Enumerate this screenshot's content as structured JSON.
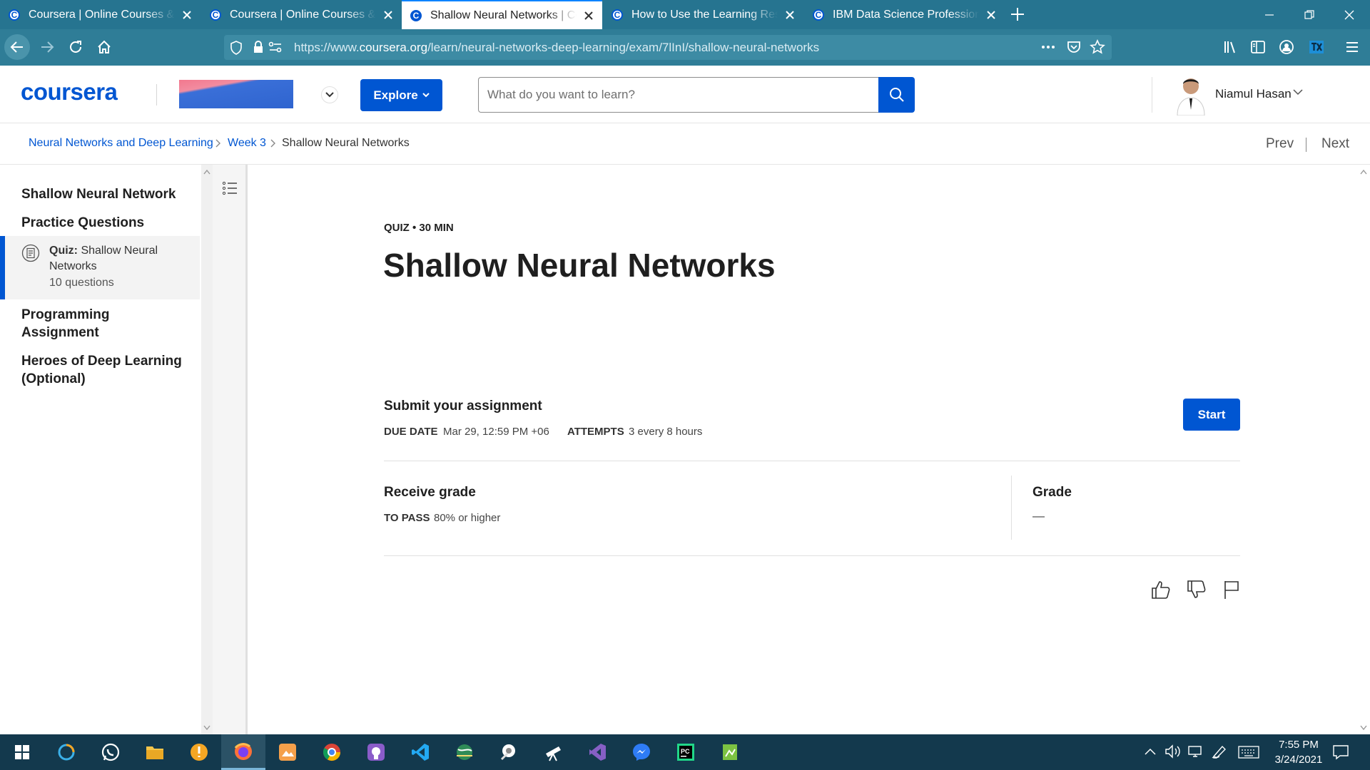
{
  "browser": {
    "tabs": [
      {
        "title": "Coursera | Online Courses & Credentials From Top Educators",
        "active": false
      },
      {
        "title": "Coursera | Online Courses & Credentials From Top Educators",
        "active": false
      },
      {
        "title": "Shallow Neural Networks | Coursera",
        "active": true
      },
      {
        "title": "How to Use the Learning Resources | Coursera",
        "active": false
      },
      {
        "title": "IBM Data Science Professional Certificate | Coursera",
        "active": false
      }
    ],
    "url_prefix": "https://www.",
    "url_domain": "coursera.org",
    "url_path": "/learn/neural-networks-deep-learning/exam/7lInI/shallow-neural-networks"
  },
  "header": {
    "logo_text": "coursera",
    "explore_label": "Explore",
    "search_placeholder": "What do you want to learn?",
    "user_name": "Niamul Hasan"
  },
  "breadcrumb": {
    "course": "Neural Networks and Deep Learning",
    "week": "Week 3",
    "current": "Shallow Neural Networks",
    "prev_label": "Prev",
    "next_label": "Next"
  },
  "sidebar": {
    "sections": [
      "Shallow Neural Network",
      "Practice Questions",
      "Programming Assignment",
      "Heroes of Deep Learning (Optional)"
    ],
    "active_item": {
      "type_label": "Quiz:",
      "title": "Shallow Neural Networks",
      "count": "10 questions"
    }
  },
  "main": {
    "meta": "QUIZ • 30 MIN",
    "title": "Shallow Neural Networks",
    "submit_title": "Submit your assignment",
    "due_label": "DUE DATE",
    "due_value": "Mar 29, 12:59 PM +06",
    "attempts_label": "ATTEMPTS",
    "attempts_value": "3 every 8 hours",
    "start_label": "Start",
    "receive_title": "Receive grade",
    "pass_label": "TO PASS",
    "pass_value": "80% or higher",
    "grade_title": "Grade",
    "grade_value": "—"
  },
  "taskbar": {
    "time": "7:55 PM",
    "date": "3/24/2021"
  },
  "colors": {
    "brand": "#0056d2",
    "tabbar": "#267490",
    "toolbar": "#2f7d97",
    "taskbar": "#13394d"
  }
}
